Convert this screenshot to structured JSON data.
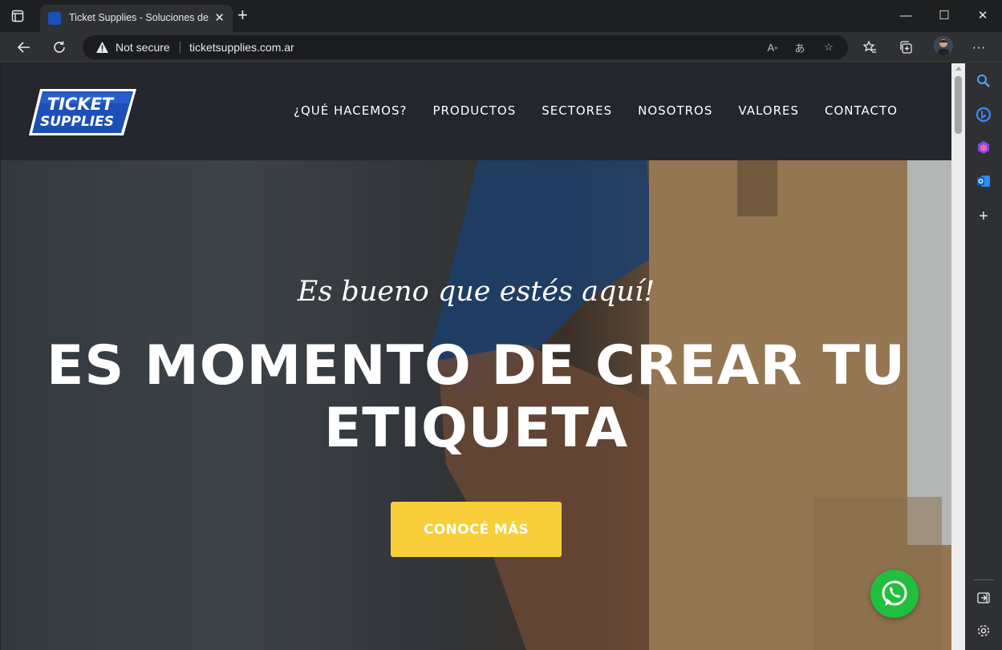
{
  "browser": {
    "tab_title": "Ticket Supplies - Soluciones de E",
    "address_security": "Not secure",
    "url": "ticketsupplies.com.ar"
  },
  "site": {
    "logo_line1": "TICKET",
    "logo_line2": "SUPPLIES",
    "nav": [
      "¿QUÉ HACEMOS?",
      "PRODUCTOS",
      "SECTORES",
      "NOSOTROS",
      "VALORES",
      "CONTACTO"
    ]
  },
  "hero": {
    "tagline": "Es bueno que estés aquí!",
    "title_line1": "ES MOMENTO DE CREAR TU",
    "title_line2": "ETIQUETA",
    "cta_label": "CONOCÉ MÁS"
  },
  "colors": {
    "header_bg": "#23262c",
    "cta_bg": "#f8cf3a",
    "whatsapp": "#21bf3e",
    "logo_blue": "#1d4fb8"
  }
}
